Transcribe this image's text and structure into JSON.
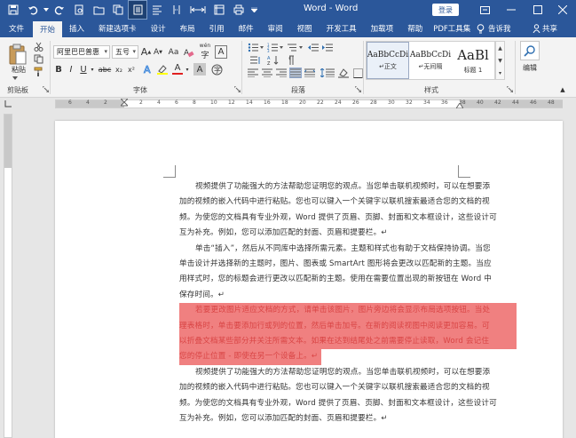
{
  "titlebar": {
    "title": "Word - Word",
    "login": "登录"
  },
  "tabs": [
    {
      "label": "文件"
    },
    {
      "label": "开始"
    },
    {
      "label": "插入"
    },
    {
      "label": "新建选项卡"
    },
    {
      "label": "设计"
    },
    {
      "label": "布局"
    },
    {
      "label": "引用"
    },
    {
      "label": "邮件"
    },
    {
      "label": "审阅"
    },
    {
      "label": "视图"
    },
    {
      "label": "开发工具"
    },
    {
      "label": "加载项"
    },
    {
      "label": "帮助"
    },
    {
      "label": "PDF工具集"
    }
  ],
  "tabs_right": {
    "tell_me": "告诉我",
    "share": "共享"
  },
  "ribbon": {
    "clipboard": {
      "paste": "粘贴",
      "group": "剪贴板"
    },
    "font": {
      "name": "阿里巴巴普惠",
      "size": "五号",
      "group": "字体",
      "grow": "A",
      "shrink": "A",
      "aa": "Aa",
      "wen": "wén",
      "bold": "B",
      "italic": "I",
      "underline": "U",
      "strike": "abc",
      "sub": "x₂",
      "sup": "x²",
      "font_color": "A",
      "char_a": "A",
      "char_border": "A",
      "phonetic": "字"
    },
    "paragraph": {
      "group": "段落"
    },
    "styles": {
      "group": "样式",
      "items": [
        {
          "preview": "AaBbCcDi",
          "name": "↵正文"
        },
        {
          "preview": "AaBbCcDi",
          "name": "↵无间隔"
        },
        {
          "preview": "AaBl",
          "name": "标题 1"
        }
      ]
    },
    "editing": {
      "label": "编辑"
    }
  },
  "ruler": {
    "numbers": [
      "8",
      "6",
      "4",
      "2",
      "2",
      "4",
      "6",
      "8",
      "10",
      "12",
      "14",
      "16",
      "18",
      "20",
      "22",
      "24",
      "26",
      "28",
      "30",
      "32",
      "34",
      "36",
      "38",
      "40",
      "42",
      "44",
      "46",
      "48"
    ]
  },
  "document": {
    "paragraphs": [
      {
        "highlight": false,
        "lines": [
          "视频提供了功能强大的方法帮助您证明您的观点。当您单击联机视频时，可以在想要添",
          "加的视频的嵌入代码中进行粘贴。您也可以键入一个关键字以联机搜索最适合您的文档的视",
          "频。为使您的文档具有专业外观，Word 提供了页眉、页脚、封面和文本框设计，这些设计可",
          "互为补充。例如，您可以添加匹配的封面、页眉和提要栏。↵"
        ]
      },
      {
        "highlight": false,
        "lines": [
          "单击“插入”，然后从不同库中选择所需元素。主题和样式也有助于文档保持协调。当您",
          "单击设计并选择新的主题时，图片、图表或 SmartArt 图形将会更改以匹配新的主题。当应",
          "用样式时，您的标题会进行更改以匹配新的主题。使用在需要位置出现的新按钮在 Word 中",
          "保存时间。↵"
        ]
      },
      {
        "highlight": true,
        "lines": [
          "若要更改图片适应文档的方式，请单击该图片，图片旁边将会显示布局选项按钮。当处",
          "理表格时，单击要添加行或列的位置，然后单击加号。在新的阅读视图中阅读更加容易。可",
          "以折叠文档某些部分并关注所需文本。如果在达到结尾处之前需要停止读取，Word 会记住",
          "您的停止位置 - 即使在另一个设备上。↵"
        ]
      },
      {
        "highlight": false,
        "lines": [
          "视频提供了功能强大的方法帮助您证明您的观点。当您单击联机视频时，可以在想要添",
          "加的视频的嵌入代码中进行粘贴。您也可以键入一个关键字以联机搜索最适合您的文档的视",
          "频。为使您的文档具有专业外观，Word 提供了页眉、页脚、封面和文本框设计，这些设计可",
          "互为补充。例如，您可以添加匹配的封面、页眉和提要栏。↵"
        ]
      }
    ]
  },
  "colors": {
    "accent": "#2b579a",
    "highlight_bg": "#f08080",
    "highlight_text": "#d94545"
  }
}
